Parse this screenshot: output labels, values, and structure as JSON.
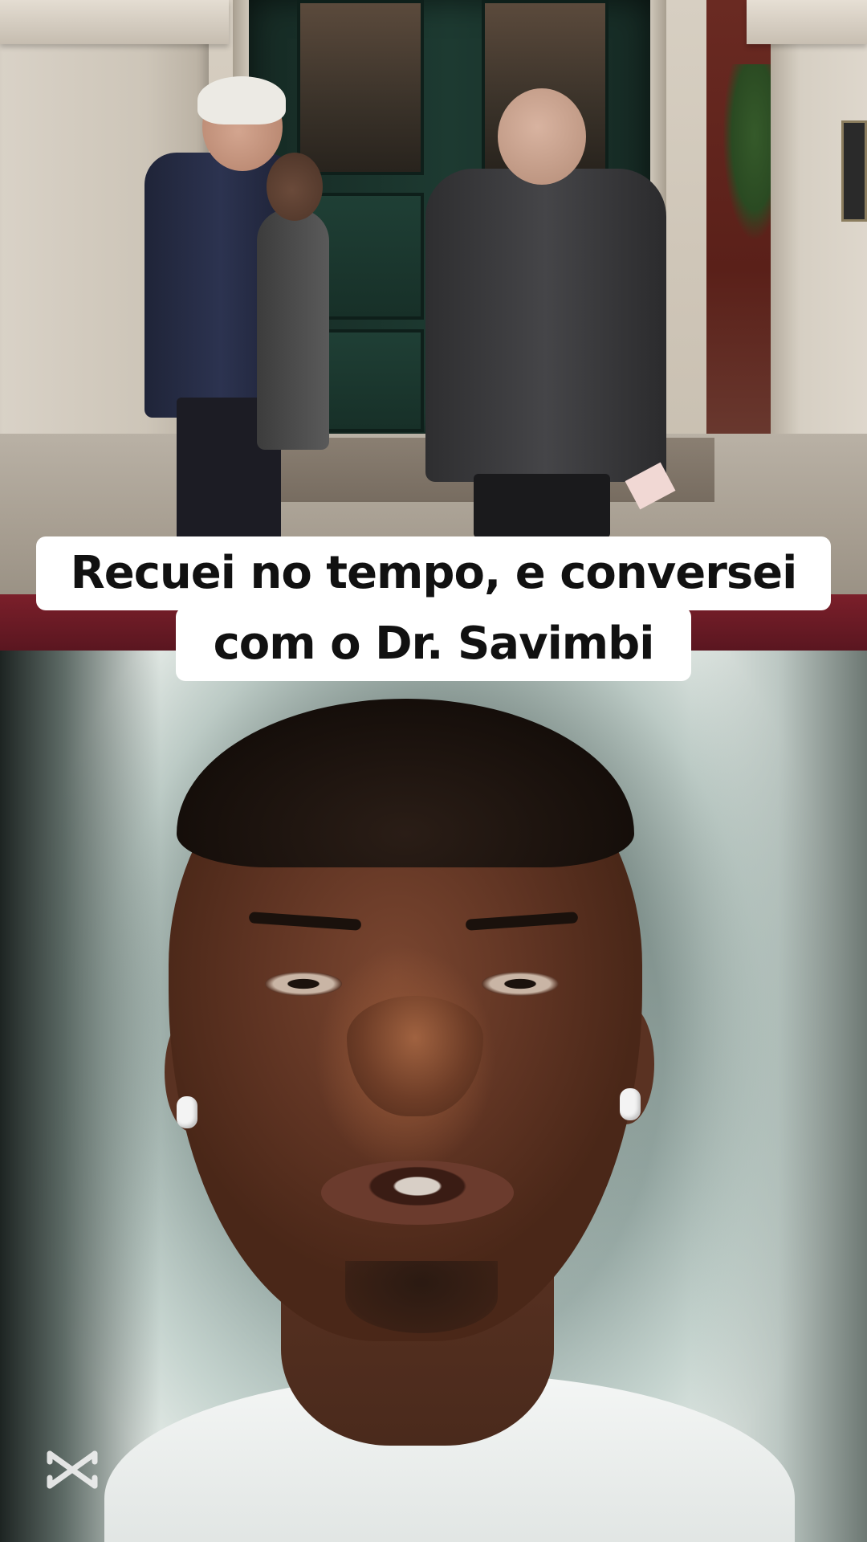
{
  "caption": {
    "line1": "Recuei no tempo, e conversei",
    "line2": "com o Dr. Savimbi"
  },
  "watermark": {
    "icon": "capcut-logo-icon"
  },
  "colors": {
    "caption_bg": "#ffffff",
    "caption_text": "#111111",
    "carpet": "#7b1f2a",
    "door": "#1d3a31"
  }
}
